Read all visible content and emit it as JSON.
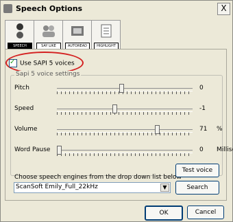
{
  "window": {
    "title": "Speech Options",
    "close_label": "X"
  },
  "tabs": [
    {
      "label": "SPEECH",
      "icon": "speech-icon"
    },
    {
      "label": "SAY LIKE",
      "icon": "people-icon"
    },
    {
      "label": "AUTOREAD",
      "icon": "autoread-icon"
    },
    {
      "label": "HIGHLIGHT",
      "icon": "document-icon"
    }
  ],
  "use_sapi": {
    "label": "Use SAPI 5 voices",
    "checked": true
  },
  "voice_settings": {
    "group_label": "Sapi 5 voice settings",
    "sliders": [
      {
        "name": "Pitch",
        "value": "0",
        "unit": "",
        "level": 0.47
      },
      {
        "name": "Speed",
        "value": "-1",
        "unit": "",
        "level": 0.42
      },
      {
        "name": "Volume",
        "value": "71",
        "unit": "%",
        "level": 0.74
      },
      {
        "name": "Word Pause",
        "value": "0",
        "unit": "Millisecs",
        "level": 0.0
      }
    ]
  },
  "engines": {
    "label": "Choose speech engines from the drop down list below",
    "selected": "ScanSoft Emily_Full_22kHz",
    "test_voice_label": "Test voice",
    "search_label": "Search"
  },
  "footer": {
    "ok_label": "OK",
    "cancel_label": "Cancel"
  }
}
